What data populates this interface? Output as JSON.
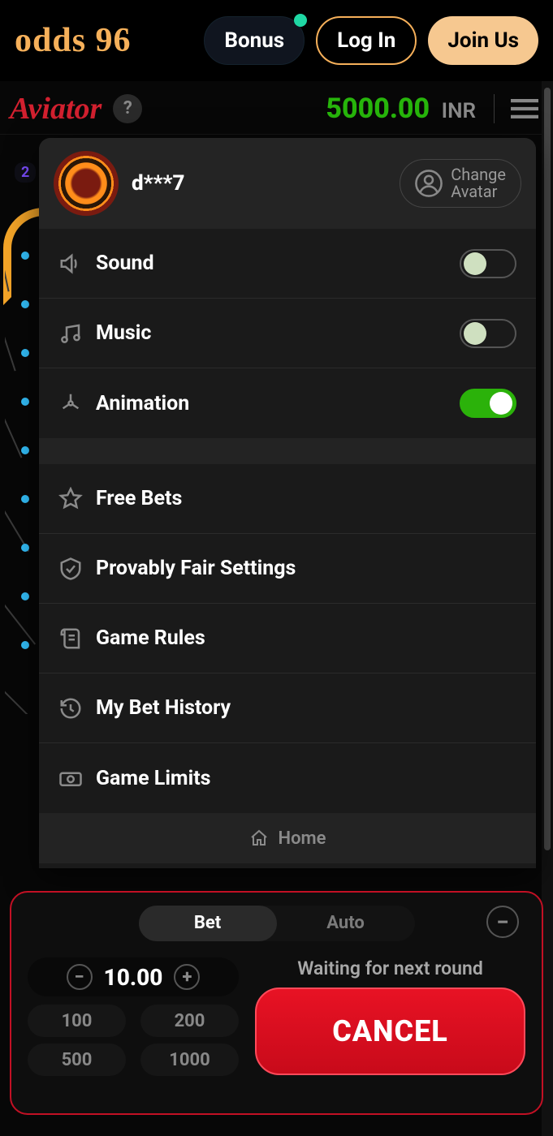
{
  "topbar": {
    "logo": "odds 96",
    "bonus": "Bonus",
    "login": "Log In",
    "join": "Join Us"
  },
  "header": {
    "title": "Aviator",
    "help": "?",
    "balance": "5000.00",
    "currency": "INR"
  },
  "bg": {
    "chip": "2"
  },
  "overlay": {
    "username": "d***7",
    "change_avatar_l1": "Change",
    "change_avatar_l2": "Avatar",
    "settings": [
      {
        "label": "Sound",
        "toggle": "off"
      },
      {
        "label": "Music",
        "toggle": "off"
      },
      {
        "label": "Animation",
        "toggle": "on"
      }
    ],
    "menu": [
      {
        "label": "Free Bets"
      },
      {
        "label": "Provably Fair Settings"
      },
      {
        "label": "Game Rules"
      },
      {
        "label": "My Bet History"
      },
      {
        "label": "Game Limits"
      }
    ],
    "home": "Home"
  },
  "bet": {
    "tab_bet": "Bet",
    "tab_auto": "Auto",
    "minus": "−",
    "plus": "+",
    "amount": "10.00",
    "quick": [
      "100",
      "200",
      "500",
      "1000"
    ],
    "waiting": "Waiting for next round",
    "cancel": "CANCEL",
    "collapse": "−"
  }
}
